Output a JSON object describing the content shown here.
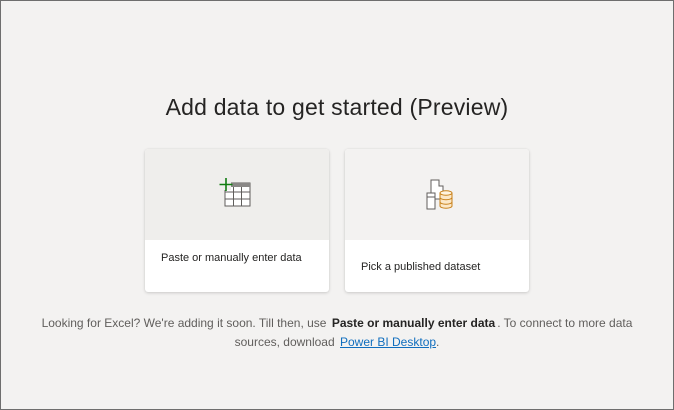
{
  "page": {
    "title": "Add data to get started (Preview)"
  },
  "cards": [
    {
      "label": "Paste or manually enter data",
      "icon": "table-add-icon"
    },
    {
      "label": "Pick a published dataset",
      "icon": "dataset-icon"
    }
  ],
  "footer": {
    "text_before": "Looking for Excel? We're adding it soon. Till then, use",
    "bold_text": "Paste or manually enter data",
    "text_middle": ". To connect to more data sources, download",
    "link_text": "Power BI Desktop",
    "text_after": "."
  },
  "colors": {
    "background": "#f3f2f1",
    "accent_green": "#107c10",
    "accent_gold": "#c8811a",
    "link": "#106ebe"
  }
}
